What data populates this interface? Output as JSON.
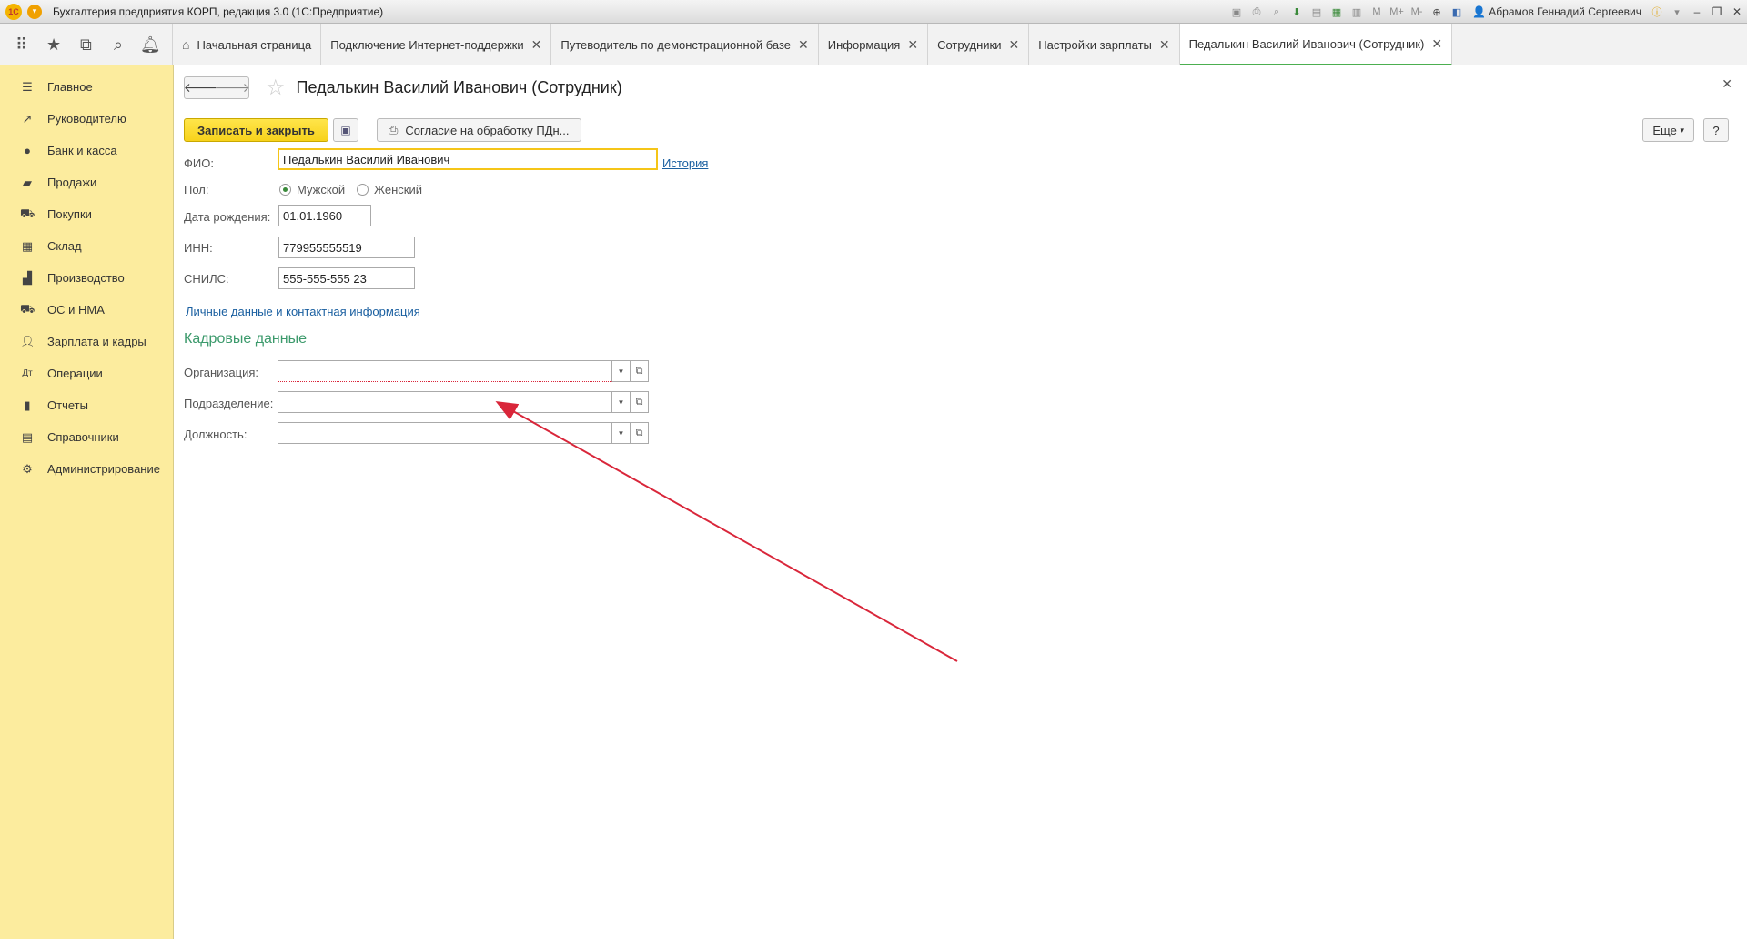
{
  "window": {
    "title": "Бухгалтерия предприятия КОРП, редакция 3.0  (1С:Предприятие)",
    "logo_text": "1С",
    "user": "Абрамов Геннадий Сергеевич",
    "toolbar_icons": [
      "save-icon",
      "print-icon",
      "preview-icon",
      "download-icon",
      "document-icon",
      "calculator-icon",
      "calendar-icon",
      "m-icon",
      "m-plus-icon",
      "m-minus-icon",
      "zoom-icon",
      "panel-icon"
    ],
    "m_labels": {
      "m": "M",
      "mplus": "M+",
      "mminus": "M-"
    }
  },
  "quick_panel": [
    "apps-icon",
    "star-icon",
    "history-icon",
    "search-icon",
    "bell-icon"
  ],
  "tabs": [
    {
      "label": "Начальная страница",
      "home": true
    },
    {
      "label": "Подключение Интернет-поддержки",
      "closable": true
    },
    {
      "label": "Путеводитель по демонстрационной базе",
      "closable": true
    },
    {
      "label": "Информация",
      "closable": true
    },
    {
      "label": "Сотрудники",
      "closable": true
    },
    {
      "label": "Настройки зарплаты",
      "closable": true
    },
    {
      "label": "Педалькин Василий Иванович (Сотрудник)",
      "closable": true,
      "active": true
    }
  ],
  "sidebar": {
    "items": [
      {
        "label": "Главное",
        "icon": "menu-icon"
      },
      {
        "label": "Руководителю",
        "icon": "chart-line-icon"
      },
      {
        "label": "Банк и касса",
        "icon": "coin-icon"
      },
      {
        "label": "Продажи",
        "icon": "bag-icon"
      },
      {
        "label": "Покупки",
        "icon": "cart-icon"
      },
      {
        "label": "Склад",
        "icon": "grid-icon"
      },
      {
        "label": "Производство",
        "icon": "factory-icon"
      },
      {
        "label": "ОС и НМА",
        "icon": "truck-icon"
      },
      {
        "label": "Зарплата и кадры",
        "icon": "person-icon"
      },
      {
        "label": "Операции",
        "icon": "operations-icon"
      },
      {
        "label": "Отчеты",
        "icon": "bar-chart-icon"
      },
      {
        "label": "Справочники",
        "icon": "book-icon"
      },
      {
        "label": "Администрирование",
        "icon": "gear-icon"
      }
    ]
  },
  "form": {
    "title": "Педалькин Василий Иванович (Сотрудник)",
    "buttons": {
      "save_close": "Записать и закрыть",
      "consent": "Согласие на обработку ПДн...",
      "more": "Еще",
      "help": "?"
    },
    "fio_label": "ФИО:",
    "fio_value": "Педалькин Василий Иванович",
    "history_link": "История",
    "gender_label": "Пол:",
    "gender_male": "Мужской",
    "gender_female": "Женский",
    "gender_selected": "male",
    "birth_label": "Дата рождения:",
    "birth_value": "01.01.1960",
    "inn_label": "ИНН:",
    "inn_value": "779955555519",
    "snils_label": "СНИЛС:",
    "snils_value": "555-555-555 23",
    "personal_link": "Личные данные и контактная информация",
    "hr_title": "Кадровые данные",
    "org_label": "Организация:",
    "org_value": "",
    "dept_label": "Подразделение:",
    "dept_value": "",
    "pos_label": "Должность:",
    "pos_value": ""
  },
  "colors": {
    "sidebar_bg": "#fcec9e",
    "primary_button": "#f7d21b",
    "section_title": "#3c9a6c",
    "link": "#1a5fa0",
    "annotation_arrow": "#d9263a",
    "active_tab_underline": "#4caf50"
  }
}
